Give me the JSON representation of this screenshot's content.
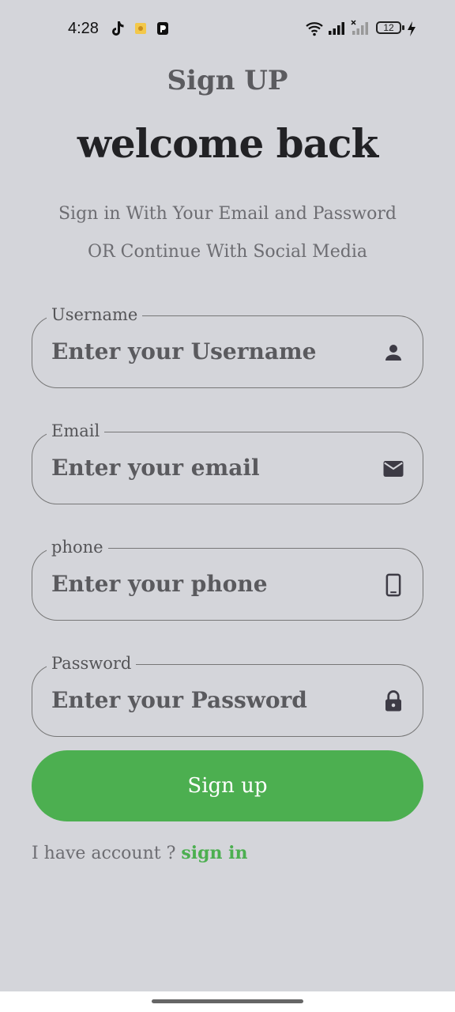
{
  "status_bar": {
    "time": "4:28",
    "battery": "12",
    "icons": [
      "tiktok-icon",
      "app-icon",
      "parking-icon",
      "wifi-icon",
      "signal-icon",
      "signal-off-icon",
      "battery-icon",
      "charging-icon"
    ]
  },
  "header": {
    "title": "Sign UP",
    "headline": "welcome back",
    "subtitle_line1": "Sign in With Your Email and Password",
    "subtitle_line2": "OR Continue With Social Media"
  },
  "form": {
    "username": {
      "label": "Username",
      "placeholder": "Enter your Username",
      "icon": "person-icon"
    },
    "email": {
      "label": "Email",
      "placeholder": "Enter your email",
      "icon": "mail-icon"
    },
    "phone": {
      "label": "phone",
      "placeholder": "Enter your phone",
      "icon": "phone-icon"
    },
    "password": {
      "label": "Password",
      "placeholder": "Enter your Password",
      "icon": "lock-icon"
    }
  },
  "actions": {
    "signup_label": "Sign up",
    "footer_text": "I have account ? ",
    "signin_link": "sign in"
  },
  "colors": {
    "background": "#d4d5da",
    "accent": "#4caf50",
    "text_dark": "#222225",
    "text_muted": "#6d6d72"
  }
}
